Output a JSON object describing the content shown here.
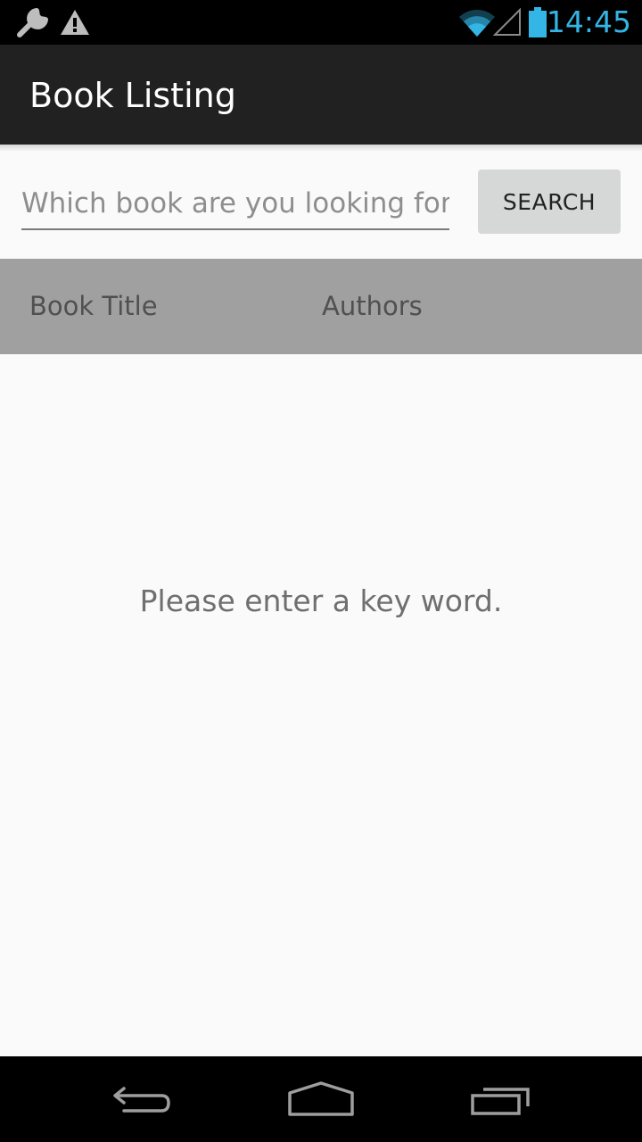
{
  "status_bar": {
    "time": "14:45",
    "icons": [
      "wrench-icon",
      "warning-icon",
      "wifi-icon",
      "signal-icon",
      "battery-icon"
    ],
    "time_color": "#33b5e5"
  },
  "action_bar": {
    "title": "Book Listing",
    "background": "#212121"
  },
  "search": {
    "placeholder": "Which book are you looking for?",
    "value": "",
    "button_label": "SEARCH"
  },
  "table_header": {
    "columns": [
      "Book Title",
      "Authors"
    ],
    "background": "#a0a0a0"
  },
  "empty_state": {
    "message": "Please enter a key word."
  },
  "nav_bar": {
    "buttons": [
      "back-icon",
      "home-icon",
      "recent-apps-icon"
    ]
  }
}
